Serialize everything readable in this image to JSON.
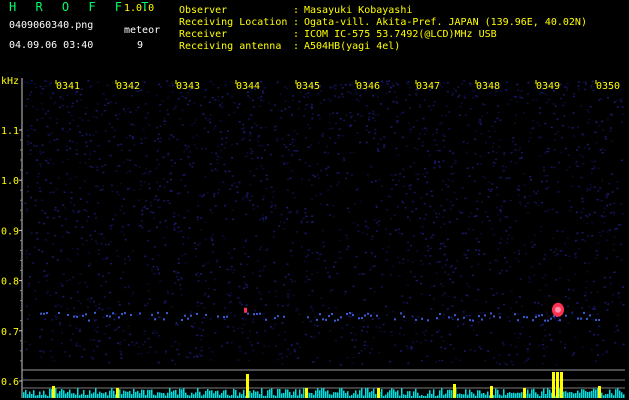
{
  "app": {
    "brand": "H R O F F T",
    "version": "1.0.0",
    "filename": "0409060340.png",
    "timestamp": "04.09.06 03:40",
    "meteor_label": "meteor",
    "meteor_count": "9"
  },
  "info": [
    {
      "key": "Observer",
      "sep": ":",
      "value": "Masayuki Kobayashi"
    },
    {
      "key": "Receiving Location",
      "sep": ":",
      "value": "Ogata-vill. Akita-Pref. JAPAN (139.96E, 40.02N)"
    },
    {
      "key": "Receiver",
      "sep": ":",
      "value": "ICOM IC-575 53.7492(@LCD)MHz USB"
    },
    {
      "key": "Receiving antenna",
      "sep": ":",
      "value": "A504HB(yagi 4el)"
    }
  ],
  "spectrogram": {
    "y_unit": "kHz",
    "time_ticks": [
      "0341",
      "0342",
      "0343",
      "0344",
      "0345",
      "0346",
      "0347",
      "0348",
      "0349",
      "0350"
    ],
    "freq_ticks": [
      "1.1",
      "1.0",
      "0.9",
      "0.8",
      "0.7",
      "0.6"
    ],
    "freq_values": [
      1.1,
      1.0,
      0.9,
      0.8,
      0.7,
      0.6
    ]
  },
  "colors": {
    "label_yellow": "#ffff00",
    "brand_green": "#00ff66",
    "signal_blue": "#3b5bd6",
    "meteor_red": "#ff3050",
    "level_cyan": "#00e0e0"
  }
}
